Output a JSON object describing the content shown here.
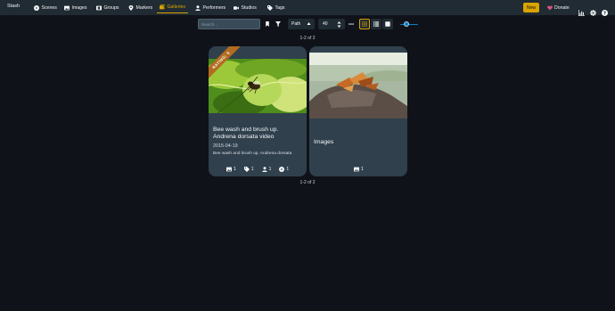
{
  "nav": {
    "brand": "Stash",
    "items": [
      {
        "label": "Scenes",
        "icon": "play-circle-icon"
      },
      {
        "label": "Images",
        "icon": "image-icon"
      },
      {
        "label": "Groups",
        "icon": "film-icon"
      },
      {
        "label": "Markers",
        "icon": "map-marker-icon"
      },
      {
        "label": "Galleries",
        "icon": "images-icon",
        "active": true
      },
      {
        "label": "Performers",
        "icon": "user-icon"
      },
      {
        "label": "Studios",
        "icon": "video-icon"
      },
      {
        "label": "Tags",
        "icon": "tag-icon"
      }
    ],
    "new_label": "New",
    "donate_label": "Donate",
    "accent": "#d9a300"
  },
  "toolbar": {
    "search_placeholder": "Search...",
    "sort_by": "Path",
    "per_page": "40",
    "zoom_level": 0.35
  },
  "pagination": {
    "top": "1-2 of 2",
    "bottom": "1-2 of 2"
  },
  "cards": [
    {
      "ribbon": "RATING: 5",
      "title": "Bee wash and brush up. Andrena dorsata video",
      "date": "2015-04-19",
      "description": "Bee wash and brush up. Andrena dorsata",
      "stats": {
        "images": "1",
        "tags": "1",
        "performers": "1",
        "scenes": "1"
      }
    },
    {
      "title": "Images",
      "stats": {
        "images": "1"
      }
    }
  ]
}
